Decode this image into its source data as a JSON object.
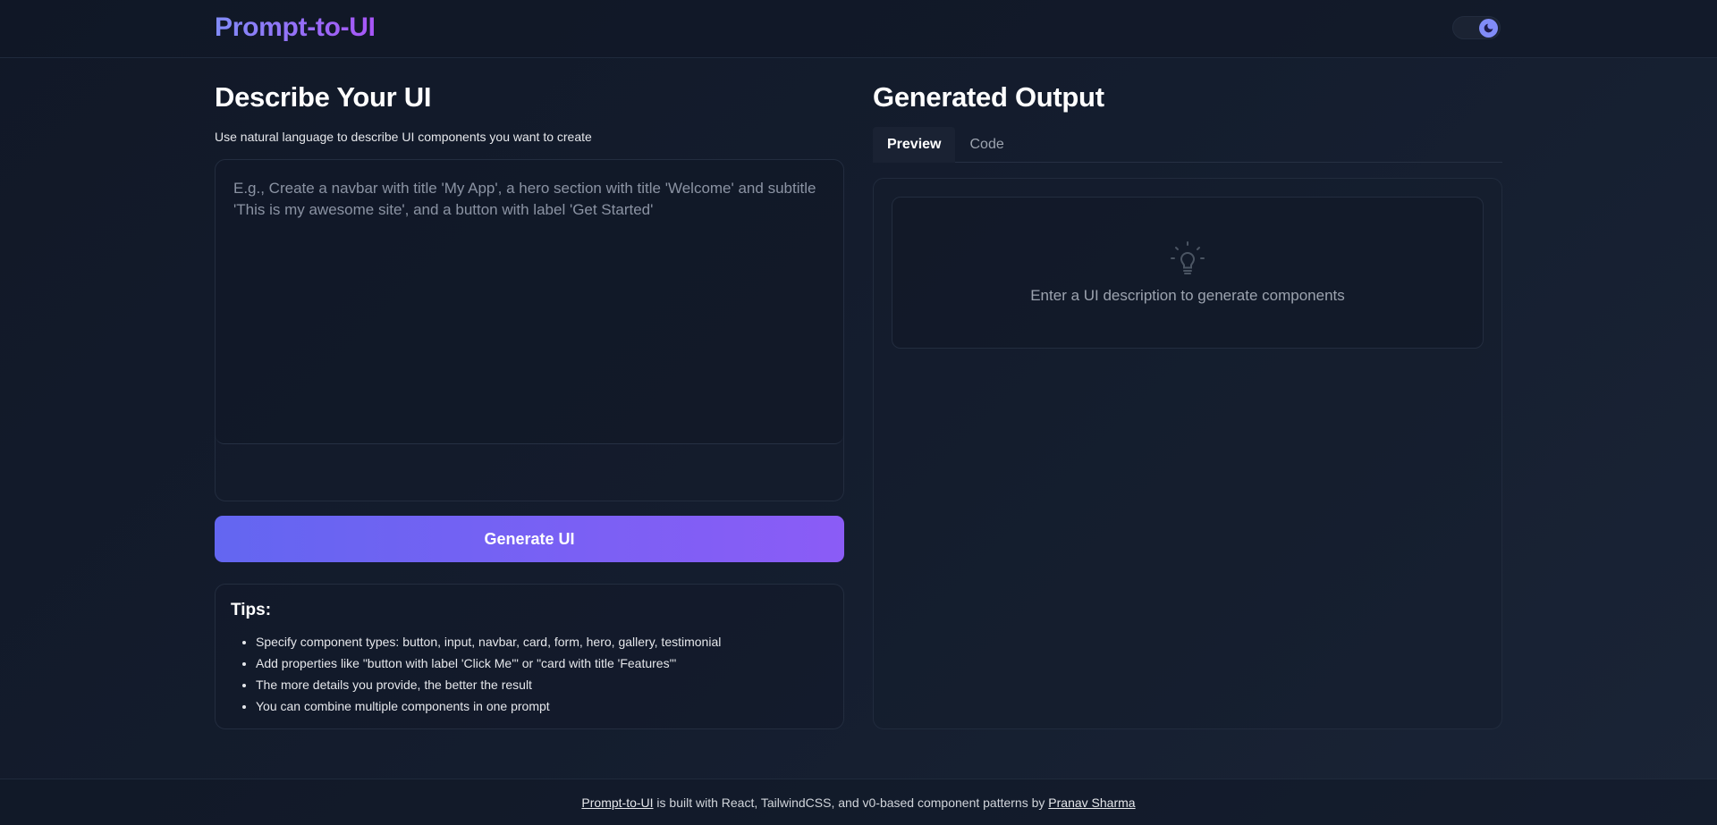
{
  "header": {
    "brand": "Prompt-to-UI",
    "theme_toggle_icon": "moon-icon"
  },
  "input_panel": {
    "title": "Describe Your UI",
    "subtitle": "Use natural language to describe UI components you want to create",
    "prompt_placeholder": "E.g., Create a navbar with title 'My App', a hero section with title 'Welcome' and subtitle 'This is my awesome site', and a button with label 'Get Started'",
    "prompt_value": "",
    "generate_label": "Generate UI"
  },
  "tips": {
    "title": "Tips:",
    "items": [
      "Specify component types: button, input, navbar, card, form, hero, gallery, testimonial",
      "Add properties like \"button with label 'Click Me'\" or \"card with title 'Features'\"",
      "The more details you provide, the better the result",
      "You can combine multiple components in one prompt"
    ]
  },
  "output_panel": {
    "title": "Generated Output",
    "tabs": [
      {
        "label": "Preview",
        "active": true
      },
      {
        "label": "Code",
        "active": false
      }
    ],
    "empty_icon": "lightbulb-icon",
    "empty_message": "Enter a UI description to generate components"
  },
  "footer": {
    "project_link": "Prompt-to-UI",
    "middle_text": " is built with React, TailwindCSS, and v0-based component patterns by ",
    "author_link": "Pranav Sharma"
  },
  "colors": {
    "accent_start": "#6366f1",
    "accent_end": "#8b5cf6",
    "background": "#111827"
  }
}
